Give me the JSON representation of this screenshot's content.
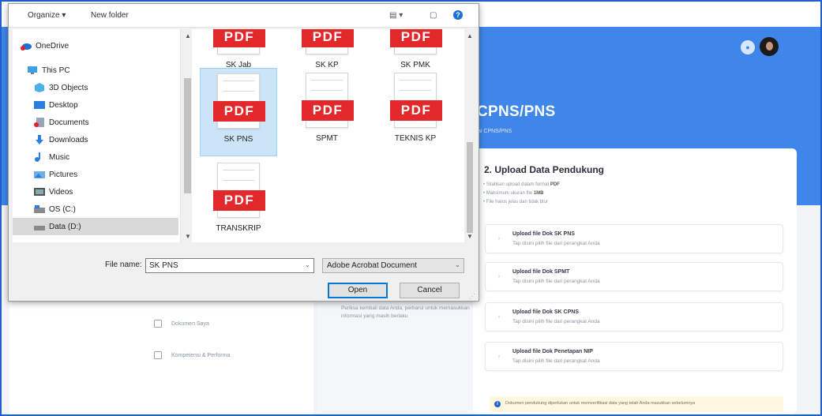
{
  "dialog": {
    "toolbar": {
      "organize": "Organize ▾",
      "new_folder": "New folder",
      "help": "?"
    },
    "nav_items": [
      {
        "label": "OneDrive",
        "icon": "cloud-icon",
        "selected": false
      },
      {
        "label": "This PC",
        "icon": "computer-icon",
        "selected": false
      },
      {
        "label": "3D Objects",
        "icon": "cube-icon",
        "selected": false
      },
      {
        "label": "Desktop",
        "icon": "desktop-icon",
        "selected": false
      },
      {
        "label": "Documents",
        "icon": "documents-icon",
        "selected": false
      },
      {
        "label": "Downloads",
        "icon": "download-icon",
        "selected": false
      },
      {
        "label": "Music",
        "icon": "music-icon",
        "selected": false
      },
      {
        "label": "Pictures",
        "icon": "pictures-icon",
        "selected": false
      },
      {
        "label": "Videos",
        "icon": "videos-icon",
        "selected": false
      },
      {
        "label": "OS (C:)",
        "icon": "drive-icon",
        "selected": false
      },
      {
        "label": "Data (D:)",
        "icon": "drive-icon",
        "selected": true
      }
    ],
    "files": [
      {
        "name": "SK Jab",
        "badge": "PDF"
      },
      {
        "name": "SK KP",
        "badge": "PDF"
      },
      {
        "name": "SK PMK",
        "badge": "PDF"
      },
      {
        "name": "SK PNS",
        "badge": "PDF",
        "selected": true
      },
      {
        "name": "SPMT",
        "badge": "PDF"
      },
      {
        "name": "TEKNIS KP",
        "badge": "PDF"
      },
      {
        "name": "TRANSKRIP",
        "badge": "PDF"
      }
    ],
    "file_name_label": "File name:",
    "file_name_value": "SK PNS",
    "file_type": "Adobe Acrobat Document",
    "open_label": "Open",
    "cancel_label": "Cancel"
  },
  "page": {
    "header_title": "CPNS/PNS",
    "header_subtitle": "ai CPNS/PNS",
    "menu": [
      {
        "label": "Dokumen Saya",
        "icon": "document-icon"
      },
      {
        "label": "Kompetensi & Performa",
        "icon": "grid-icon"
      }
    ],
    "mid_text": "Periksa kembali data Anda, perbarui untuk memasukkan informasi yang masih berlaku",
    "card_title": "2. Upload Data Pendukung",
    "notes": [
      {
        "text": "Silahkan upload dalam format ",
        "bold": "PDF"
      },
      {
        "text": "Maksimum ukuran file ",
        "bold": "1MB"
      },
      {
        "text": "File harus jelas dan tidak blur",
        "bold": ""
      }
    ],
    "uploads": [
      {
        "title": "Upload file Dok SK PNS",
        "hint": "Tap disini pilih file dari perangkat Anda"
      },
      {
        "title": "Upload file Dok SPMT",
        "hint": "Tap disini pilih file dari perangkat Anda"
      },
      {
        "title": "Upload file Dok SK CPNS",
        "hint": "Tap disini pilih file dari perangkat Anda"
      },
      {
        "title": "Upload file Dok Penetapan NIP",
        "hint": "Tap disini pilih file dari perangkat Anda"
      }
    ],
    "info_text": "Dokumen pendukung diperlukan untuk memverifikasi data yang telah Anda masukkan sebelumnya",
    "info_icon": "i"
  },
  "colors": {
    "pdf_red": "#e2282a",
    "brand_blue": "#3f86ea",
    "selection": "#cce4f7"
  }
}
